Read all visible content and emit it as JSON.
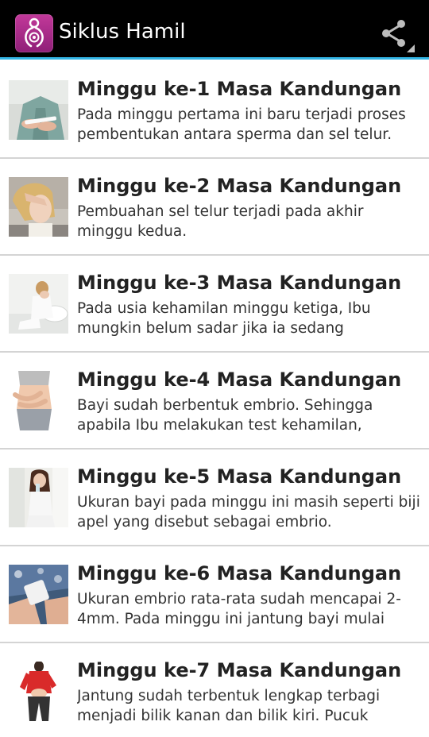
{
  "app": {
    "title": "Siklus Hamil",
    "icon": "pregnant-woman-icon",
    "share_icon": "share-icon",
    "accent_color": "#33b5e5",
    "icon_color": "#b0308e"
  },
  "list": {
    "items": [
      {
        "title": "Minggu ke-1 Masa Kandungan",
        "description": "Pada minggu pertama ini baru terjadi proses pembentukan antara sperma dan sel telur.",
        "thumbnail": "pregnancy-test-photo"
      },
      {
        "title": "Minggu ke-2 Masa Kandungan",
        "description": "Pembuahan sel telur terjadi pada akhir minggu kedua.",
        "thumbnail": "tired-woman-photo"
      },
      {
        "title": "Minggu ke-3 Masa Kandungan",
        "description": "Pada usia kehamilan minggu ketiga, Ibu mungkin belum sadar jika ia sedang",
        "thumbnail": "woman-bathroom-photo"
      },
      {
        "title": "Minggu ke-4 Masa Kandungan",
        "description": "Bayi sudah berbentuk embrio. Sehingga apabila Ibu melakukan test kehamilan,",
        "thumbnail": "belly-hands-photo"
      },
      {
        "title": "Minggu ke-5 Masa Kandungan",
        "description": "Ukuran bayi pada minggu ini masih seperti biji apel yang disebut sebagai embrio.",
        "thumbnail": "woman-drinking-photo"
      },
      {
        "title": "Minggu ke-6 Masa Kandungan",
        "description": "Ukuran embrio rata-rata sudah mencapai 2-4mm. Pada minggu ini jantung bayi mulai",
        "thumbnail": "mug-hands-photo"
      },
      {
        "title": "Minggu ke-7 Masa Kandungan",
        "description": "Jantung sudah terbentuk lengkap terbagi menjadi bilik kanan dan bilik kiri. Pucuk",
        "thumbnail": "woman-red-top-photo"
      }
    ]
  }
}
